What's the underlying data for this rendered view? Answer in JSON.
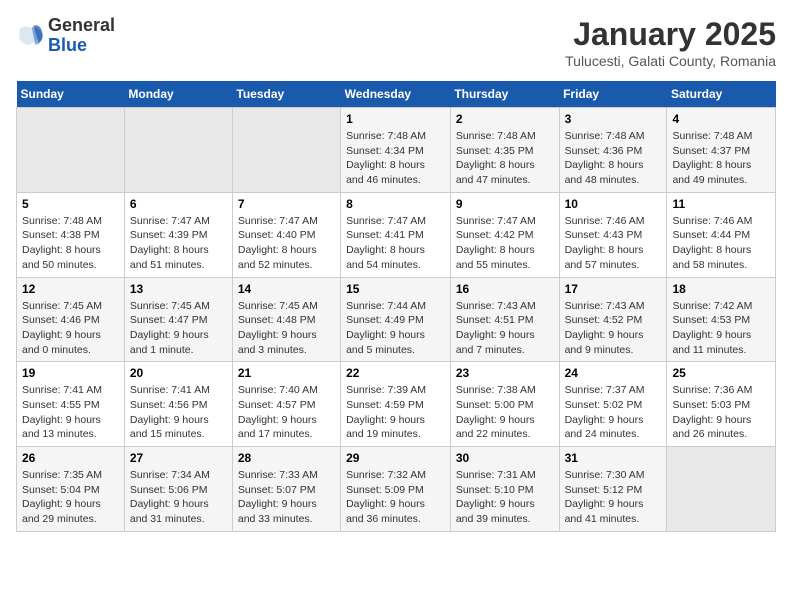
{
  "header": {
    "logo_general": "General",
    "logo_blue": "Blue",
    "month_title": "January 2025",
    "subtitle": "Tulucesti, Galati County, Romania"
  },
  "weekdays": [
    "Sunday",
    "Monday",
    "Tuesday",
    "Wednesday",
    "Thursday",
    "Friday",
    "Saturday"
  ],
  "weeks": [
    [
      {
        "day": "",
        "empty": true
      },
      {
        "day": "",
        "empty": true
      },
      {
        "day": "",
        "empty": true
      },
      {
        "day": "1",
        "sunrise": "7:48 AM",
        "sunset": "4:34 PM",
        "daylight": "8 hours and 46 minutes."
      },
      {
        "day": "2",
        "sunrise": "7:48 AM",
        "sunset": "4:35 PM",
        "daylight": "8 hours and 47 minutes."
      },
      {
        "day": "3",
        "sunrise": "7:48 AM",
        "sunset": "4:36 PM",
        "daylight": "8 hours and 48 minutes."
      },
      {
        "day": "4",
        "sunrise": "7:48 AM",
        "sunset": "4:37 PM",
        "daylight": "8 hours and 49 minutes."
      }
    ],
    [
      {
        "day": "5",
        "sunrise": "7:48 AM",
        "sunset": "4:38 PM",
        "daylight": "8 hours and 50 minutes."
      },
      {
        "day": "6",
        "sunrise": "7:47 AM",
        "sunset": "4:39 PM",
        "daylight": "8 hours and 51 minutes."
      },
      {
        "day": "7",
        "sunrise": "7:47 AM",
        "sunset": "4:40 PM",
        "daylight": "8 hours and 52 minutes."
      },
      {
        "day": "8",
        "sunrise": "7:47 AM",
        "sunset": "4:41 PM",
        "daylight": "8 hours and 54 minutes."
      },
      {
        "day": "9",
        "sunrise": "7:47 AM",
        "sunset": "4:42 PM",
        "daylight": "8 hours and 55 minutes."
      },
      {
        "day": "10",
        "sunrise": "7:46 AM",
        "sunset": "4:43 PM",
        "daylight": "8 hours and 57 minutes."
      },
      {
        "day": "11",
        "sunrise": "7:46 AM",
        "sunset": "4:44 PM",
        "daylight": "8 hours and 58 minutes."
      }
    ],
    [
      {
        "day": "12",
        "sunrise": "7:45 AM",
        "sunset": "4:46 PM",
        "daylight": "9 hours and 0 minutes."
      },
      {
        "day": "13",
        "sunrise": "7:45 AM",
        "sunset": "4:47 PM",
        "daylight": "9 hours and 1 minute."
      },
      {
        "day": "14",
        "sunrise": "7:45 AM",
        "sunset": "4:48 PM",
        "daylight": "9 hours and 3 minutes."
      },
      {
        "day": "15",
        "sunrise": "7:44 AM",
        "sunset": "4:49 PM",
        "daylight": "9 hours and 5 minutes."
      },
      {
        "day": "16",
        "sunrise": "7:43 AM",
        "sunset": "4:51 PM",
        "daylight": "9 hours and 7 minutes."
      },
      {
        "day": "17",
        "sunrise": "7:43 AM",
        "sunset": "4:52 PM",
        "daylight": "9 hours and 9 minutes."
      },
      {
        "day": "18",
        "sunrise": "7:42 AM",
        "sunset": "4:53 PM",
        "daylight": "9 hours and 11 minutes."
      }
    ],
    [
      {
        "day": "19",
        "sunrise": "7:41 AM",
        "sunset": "4:55 PM",
        "daylight": "9 hours and 13 minutes."
      },
      {
        "day": "20",
        "sunrise": "7:41 AM",
        "sunset": "4:56 PM",
        "daylight": "9 hours and 15 minutes."
      },
      {
        "day": "21",
        "sunrise": "7:40 AM",
        "sunset": "4:57 PM",
        "daylight": "9 hours and 17 minutes."
      },
      {
        "day": "22",
        "sunrise": "7:39 AM",
        "sunset": "4:59 PM",
        "daylight": "9 hours and 19 minutes."
      },
      {
        "day": "23",
        "sunrise": "7:38 AM",
        "sunset": "5:00 PM",
        "daylight": "9 hours and 22 minutes."
      },
      {
        "day": "24",
        "sunrise": "7:37 AM",
        "sunset": "5:02 PM",
        "daylight": "9 hours and 24 minutes."
      },
      {
        "day": "25",
        "sunrise": "7:36 AM",
        "sunset": "5:03 PM",
        "daylight": "9 hours and 26 minutes."
      }
    ],
    [
      {
        "day": "26",
        "sunrise": "7:35 AM",
        "sunset": "5:04 PM",
        "daylight": "9 hours and 29 minutes."
      },
      {
        "day": "27",
        "sunrise": "7:34 AM",
        "sunset": "5:06 PM",
        "daylight": "9 hours and 31 minutes."
      },
      {
        "day": "28",
        "sunrise": "7:33 AM",
        "sunset": "5:07 PM",
        "daylight": "9 hours and 33 minutes."
      },
      {
        "day": "29",
        "sunrise": "7:32 AM",
        "sunset": "5:09 PM",
        "daylight": "9 hours and 36 minutes."
      },
      {
        "day": "30",
        "sunrise": "7:31 AM",
        "sunset": "5:10 PM",
        "daylight": "9 hours and 39 minutes."
      },
      {
        "day": "31",
        "sunrise": "7:30 AM",
        "sunset": "5:12 PM",
        "daylight": "9 hours and 41 minutes."
      },
      {
        "day": "",
        "empty": true
      }
    ]
  ]
}
